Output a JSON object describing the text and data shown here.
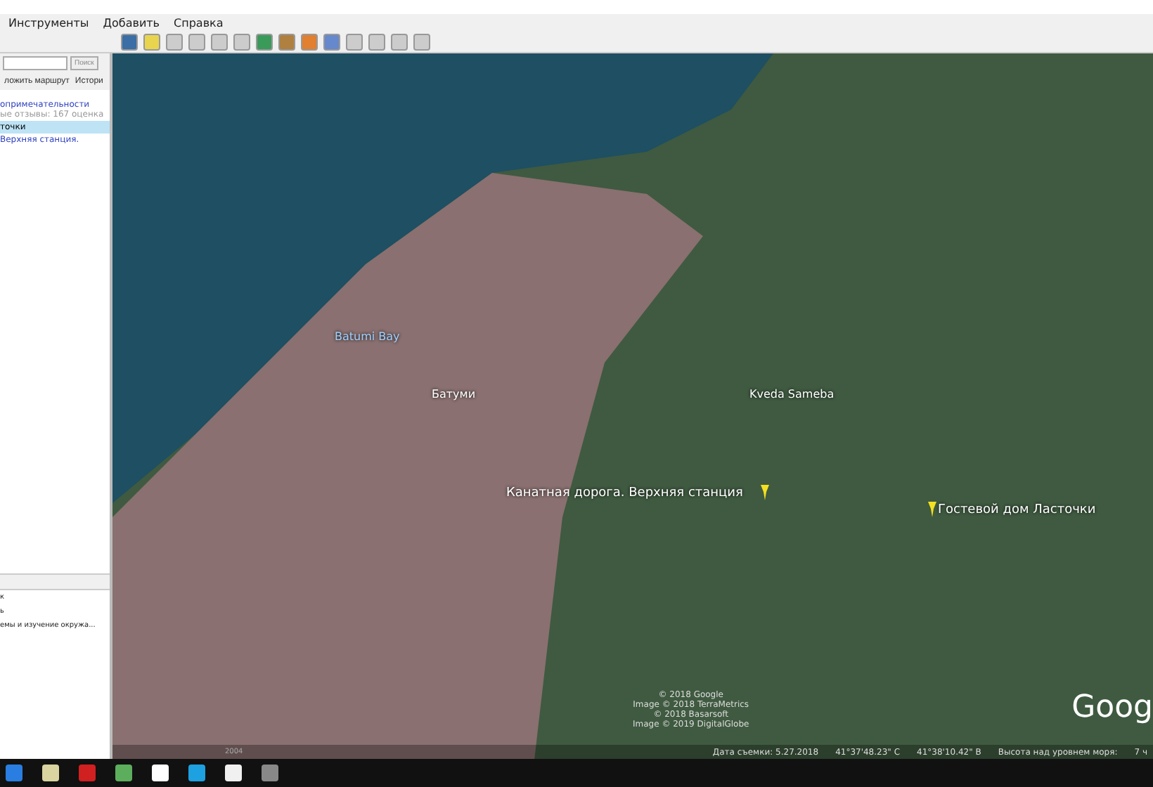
{
  "menu": [
    "Инструменты",
    "Добавить",
    "Справка"
  ],
  "search": {
    "button": "Поиск"
  },
  "panel_tabs": [
    {
      "label": "ложить маршрут",
      "selected": false
    },
    {
      "label": "Истори",
      "selected": false
    }
  ],
  "results": [
    {
      "title": "опримечательности",
      "subtitle": "ые отзывы: 167 оценка",
      "selected": false
    },
    {
      "title": "точки",
      "selected": true
    },
    {
      "title": "Верхняя станция.",
      "selected": false
    }
  ],
  "places": [
    {
      "label": "к"
    },
    {
      "label": "ь"
    },
    {
      "label": "емы и изучение окружа..."
    }
  ],
  "map": {
    "labels": [
      {
        "kind": "water",
        "text": "Batumi Bay"
      },
      {
        "kind": "city",
        "text": "Батуми"
      },
      {
        "kind": "city",
        "text": "Kveda Sameba"
      },
      {
        "kind": "pin",
        "text": "Канатная дорога. Верхняя станция"
      },
      {
        "kind": "pin",
        "text": "Гостевой дом Ласточки"
      }
    ],
    "credits": [
      "© 2018 Google",
      "Image © 2018 TerraMetrics",
      "© 2018 Basarsoft",
      "Image © 2019 DigitalGlobe"
    ],
    "logo": "Goog",
    "year": "2004"
  },
  "status_bar": [
    "Дата съемки: 5.27.2018",
    "41°37'48.23\" С",
    "41°38'10.42\" В",
    "Высота над уровнем моря:",
    "7 ч"
  ]
}
